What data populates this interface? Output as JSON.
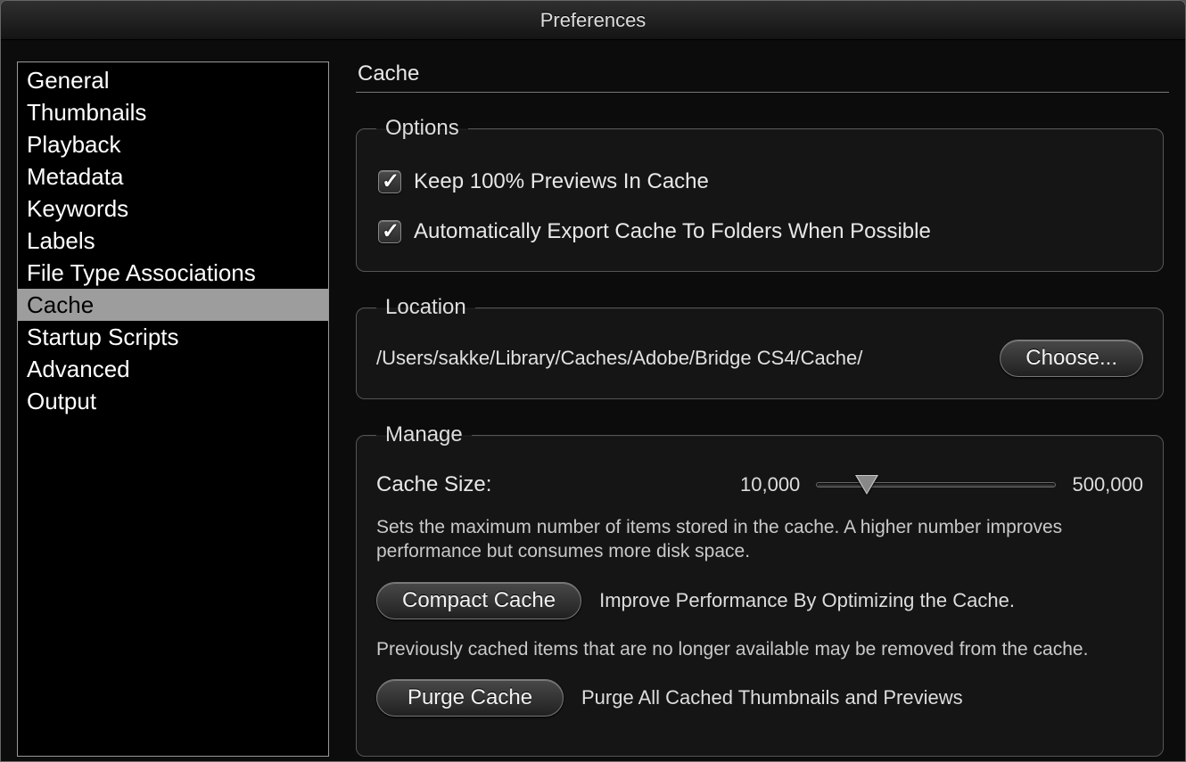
{
  "window": {
    "title": "Preferences"
  },
  "sidebar": {
    "items": [
      {
        "label": "General",
        "selected": false
      },
      {
        "label": "Thumbnails",
        "selected": false
      },
      {
        "label": "Playback",
        "selected": false
      },
      {
        "label": "Metadata",
        "selected": false
      },
      {
        "label": "Keywords",
        "selected": false
      },
      {
        "label": "Labels",
        "selected": false
      },
      {
        "label": "File Type Associations",
        "selected": false
      },
      {
        "label": "Cache",
        "selected": true
      },
      {
        "label": "Startup Scripts",
        "selected": false
      },
      {
        "label": "Advanced",
        "selected": false
      },
      {
        "label": "Output",
        "selected": false
      }
    ]
  },
  "panel": {
    "title": "Cache",
    "options": {
      "legend": "Options",
      "keep_previews_label": "Keep 100% Previews In Cache",
      "keep_previews_checked": true,
      "auto_export_label": "Automatically Export Cache To Folders When Possible",
      "auto_export_checked": true
    },
    "location": {
      "legend": "Location",
      "path": "/Users/sakke/Library/Caches/Adobe/Bridge CS4/Cache/",
      "choose_label": "Choose..."
    },
    "manage": {
      "legend": "Manage",
      "cache_size_label": "Cache Size:",
      "min_label": "10,000",
      "max_label": "500,000",
      "slider_percent": 21,
      "size_desc": "Sets the maximum number of items stored in the cache. A higher number improves performance but consumes more disk space.",
      "compact_label": "Compact Cache",
      "compact_desc": "Improve Performance By Optimizing the Cache.",
      "compact_note": "Previously cached items that are no longer available may be removed from the cache.",
      "purge_label": "Purge Cache",
      "purge_desc": "Purge All Cached Thumbnails and Previews"
    }
  }
}
